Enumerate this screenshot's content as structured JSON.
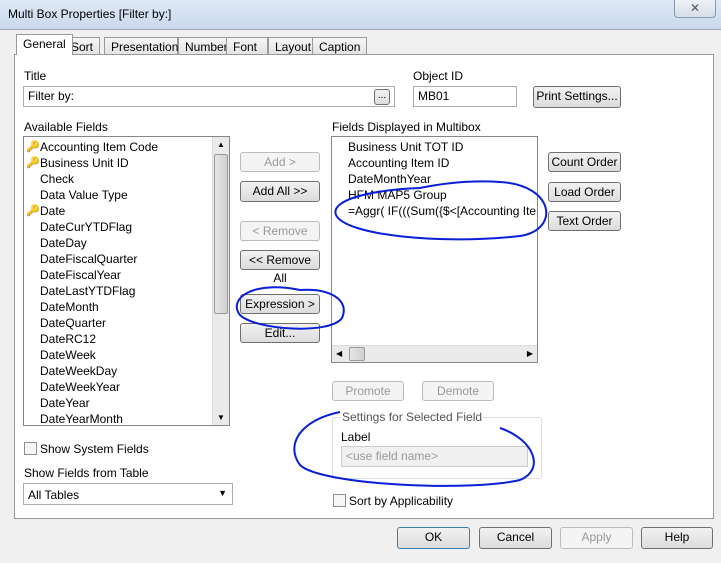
{
  "window": {
    "title": "Multi Box Properties [Filter by:]",
    "close_icon": "close-icon"
  },
  "tabs": [
    {
      "label": "General",
      "active": true
    },
    {
      "label": "Sort"
    },
    {
      "label": "Presentation"
    },
    {
      "label": "Number"
    },
    {
      "label": "Font"
    },
    {
      "label": "Layout"
    },
    {
      "label": "Caption"
    }
  ],
  "title_field": {
    "label": "Title",
    "value": "Filter by:",
    "browse_label": "..."
  },
  "object_id": {
    "label": "Object ID",
    "value": "MB01"
  },
  "print_settings_label": "Print Settings...",
  "available_fields": {
    "label": "Available Fields",
    "items": [
      {
        "text": "Accounting Item Code",
        "key": true
      },
      {
        "text": "Business Unit ID",
        "key": true
      },
      {
        "text": "Check"
      },
      {
        "text": "Data Value Type"
      },
      {
        "text": "Date",
        "key": true
      },
      {
        "text": "DateCurYTDFlag"
      },
      {
        "text": "DateDay"
      },
      {
        "text": "DateFiscalQuarter"
      },
      {
        "text": "DateFiscalYear"
      },
      {
        "text": "DateLastYTDFlag"
      },
      {
        "text": "DateMonth"
      },
      {
        "text": "DateQuarter"
      },
      {
        "text": "DateRC12"
      },
      {
        "text": "DateWeek"
      },
      {
        "text": "DateWeekDay"
      },
      {
        "text": "DateWeekYear"
      },
      {
        "text": "DateYear"
      },
      {
        "text": "DateYearMonth"
      }
    ]
  },
  "middle_buttons": {
    "add": "Add >",
    "add_all": "Add All >>",
    "remove": "< Remove",
    "remove_all": "<< Remove All",
    "expression": "Expression >",
    "edit": "Edit..."
  },
  "displayed_fields": {
    "label": "Fields Displayed in Multibox",
    "items": [
      "Business Unit TOT ID",
      "Accounting Item ID",
      "DateMonthYear",
      "HFM MAP5 Group",
      "=Aggr( IF(((Sum({$<[Accounting Item ID"
    ]
  },
  "order_buttons": {
    "count": "Count Order",
    "load": "Load Order",
    "text": "Text Order"
  },
  "promote": "Promote",
  "demote": "Demote",
  "settings": {
    "group_label": "Settings for Selected Field",
    "label": "Label",
    "placeholder": "<use field name>"
  },
  "sort_by_applicability": "Sort by Applicability",
  "show_system_fields": "Show System Fields",
  "show_fields_from_table": {
    "label": "Show Fields from Table",
    "value": "All Tables"
  },
  "footer": {
    "ok": "OK",
    "cancel": "Cancel",
    "apply": "Apply",
    "help": "Help"
  },
  "annotation_color": "#0a1fd6"
}
